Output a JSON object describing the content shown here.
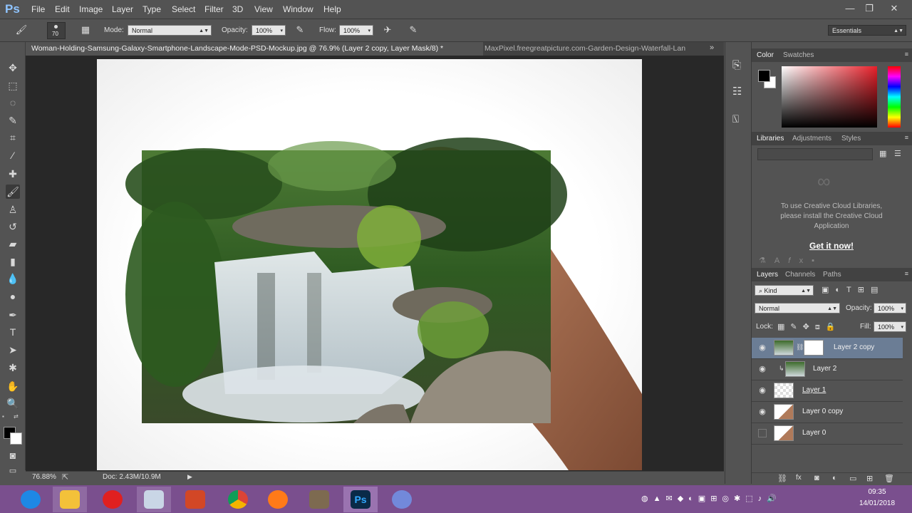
{
  "app": {
    "logo": "Ps"
  },
  "menu": [
    "File",
    "Edit",
    "Image",
    "Layer",
    "Type",
    "Select",
    "Filter",
    "3D",
    "View",
    "Window",
    "Help"
  ],
  "window_controls": {
    "minimize": "—",
    "restore": "❐",
    "close": "✕"
  },
  "options": {
    "brush_size": "70",
    "mode_label": "Mode:",
    "mode_value": "Normal",
    "opacity_label": "Opacity:",
    "opacity_value": "100%",
    "flow_label": "Flow:",
    "flow_value": "100%",
    "workspace": "Essentials"
  },
  "tabs": [
    {
      "label": "Woman-Holding-Samsung-Galaxy-Smartphone-Landscape-Mode-PSD-Mockup.jpg @ 76.9% (Layer 2 copy, Layer Mask/8) *",
      "active": true
    },
    {
      "label": "MaxPixel.freegreatpicture.com-Garden-Design-Waterfall-Lan",
      "active": false
    }
  ],
  "status": {
    "zoom": "76.88%",
    "doc": "Doc: 2.43M/10.9M"
  },
  "color_panel": {
    "tabs": [
      "Color",
      "Swatches"
    ],
    "fg": "#000000",
    "bg": "#ffffff",
    "hue_color": "#e8202a"
  },
  "libraries_panel": {
    "tabs": [
      "Libraries",
      "Adjustments",
      "Styles"
    ],
    "message": "To use Creative Cloud Libraries, please install the Creative Cloud Application",
    "link": "Get it now!"
  },
  "layers_panel": {
    "tabs": [
      "Layers",
      "Channels",
      "Paths"
    ],
    "filter": "Kind",
    "blend_mode": "Normal",
    "opacity_label": "Opacity:",
    "opacity_value": "100%",
    "lock_label": "Lock:",
    "fill_label": "Fill:",
    "fill_value": "100%",
    "layers": [
      {
        "name": "Layer 2 copy",
        "visible": true,
        "selected": true,
        "has_mask": true,
        "thumb": "waterfall"
      },
      {
        "name": "Layer 2",
        "visible": true,
        "selected": false,
        "clipped": true,
        "thumb": "waterfall"
      },
      {
        "name": "Layer 1",
        "visible": true,
        "selected": false,
        "thumb": "transparent"
      },
      {
        "name": "Layer 0 copy",
        "visible": true,
        "selected": false,
        "thumb": "hand"
      },
      {
        "name": "Layer 0",
        "visible": false,
        "selected": false,
        "thumb": "hand"
      }
    ]
  },
  "taskbar": {
    "apps": [
      "internet-explorer",
      "file-explorer",
      "opera",
      "keyboard-app",
      "powerpoint",
      "chrome",
      "firefox",
      "gimp",
      "photoshop",
      "discord"
    ],
    "time": "09:35",
    "date": "14/01/2018"
  }
}
